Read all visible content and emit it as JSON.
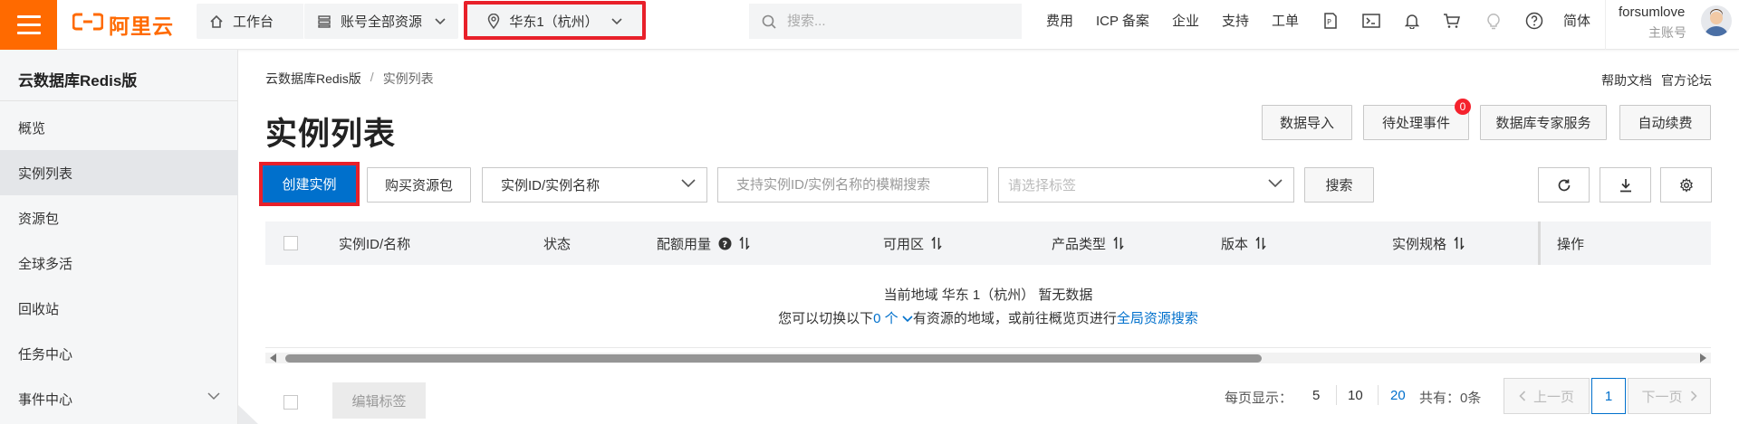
{
  "topbar": {
    "logo_text": "阿里云",
    "workbench": "工作台",
    "resources": "账号全部资源",
    "region": "华东1（杭州）",
    "search_placeholder": "搜索...",
    "nav": [
      "费用",
      "ICP 备案",
      "企业",
      "支持",
      "工单"
    ],
    "icons": [
      "ai-assistant-icon",
      "terminal-icon",
      "bell-icon",
      "cart-icon",
      "lightbulb-icon",
      "help-icon"
    ],
    "language": "简体",
    "username": "forsumlove",
    "account_type": "主账号"
  },
  "sidebar": {
    "title": "云数据库Redis版",
    "items": [
      {
        "label": "概览"
      },
      {
        "label": "实例列表",
        "active": true
      },
      {
        "label": "资源包"
      },
      {
        "label": "全球多活"
      },
      {
        "label": "回收站"
      },
      {
        "label": "任务中心"
      },
      {
        "label": "事件中心",
        "expandable": true
      }
    ]
  },
  "main": {
    "breadcrumb": [
      "云数据库Redis版",
      "/",
      "实例列表"
    ],
    "help_links": [
      "帮助文档",
      "官方论坛"
    ],
    "title": "实例列表",
    "actions": {
      "import": "数据导入",
      "pending": "待处理事件",
      "pending_count": "0",
      "expert": "数据库专家服务",
      "renew": "自动续费"
    },
    "toolbar": {
      "create": "创建实例",
      "buy_pack": "购买资源包",
      "filter_select": "实例ID/实例名称",
      "filter_placeholder": "支持实例ID/实例名称的模糊搜索",
      "tag_placeholder": "请选择标签",
      "search": "搜索"
    },
    "table": {
      "columns": [
        "实例ID/名称",
        "状态",
        "配额用量",
        "可用区",
        "产品类型",
        "版本",
        "实例规格",
        "操作"
      ],
      "empty_line1": "当前地域 华东 1（杭州） 暂无数据",
      "empty_line2_prefix": "您可以切换以下",
      "empty_line2_count": "0 个",
      "empty_line2_mid": "有资源的地域，或前往概览页进行",
      "empty_line2_link": "全局资源搜索"
    },
    "footer": {
      "edit_tags": "编辑标签",
      "page_size_label": "每页显示：",
      "page_sizes": [
        "5",
        "10",
        "20"
      ],
      "page_size_selected": "20",
      "total": "共有：0条",
      "prev": "上一页",
      "current_page": "1",
      "next": "下一页"
    }
  },
  "colors": {
    "brand": "#ff6a00",
    "primary": "#0070cc",
    "highlight_box": "#e8202a",
    "badge": "#f5222d"
  }
}
